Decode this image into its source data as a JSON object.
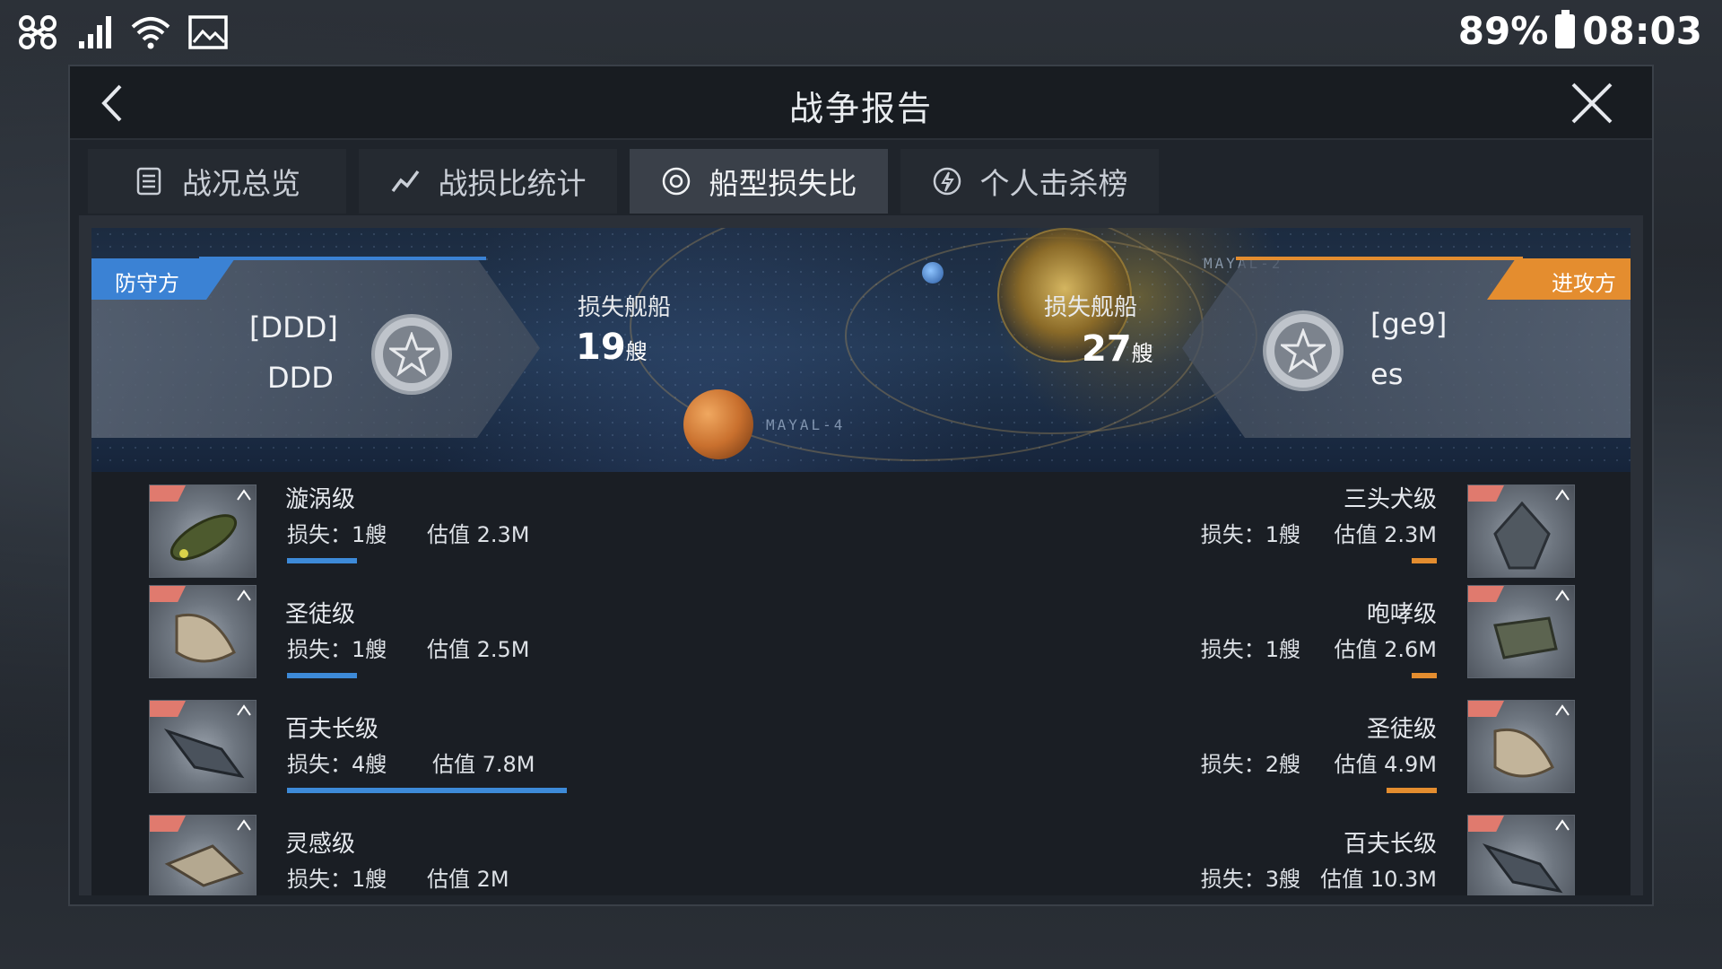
{
  "status_bar": {
    "battery_percent": "89%",
    "time": "08:03"
  },
  "dialog": {
    "title": "战争报告"
  },
  "tabs": [
    {
      "label": "战况总览",
      "icon": "document-icon",
      "active": false
    },
    {
      "label": "战损比统计",
      "icon": "trend-line-icon",
      "active": false
    },
    {
      "label": "船型损失比",
      "icon": "target-icon",
      "active": true
    },
    {
      "label": "个人击杀榜",
      "icon": "lightning-icon",
      "active": false
    }
  ],
  "banner": {
    "map_labels": [
      "MAYAL-4",
      "MAYAL-2"
    ],
    "defender": {
      "side_label": "防守方",
      "guild_tag": "[DDD]",
      "guild_name": "DDD",
      "loss_label": "损失舰船",
      "loss_count": "19",
      "loss_unit": "艘",
      "color": "#3b82d4"
    },
    "attacker": {
      "side_label": "进攻方",
      "guild_tag": "[ge9]",
      "guild_name": "es",
      "loss_label": "损失舰船",
      "loss_count": "27",
      "loss_unit": "艘",
      "color": "#e48d2f"
    }
  },
  "defender_ships": [
    {
      "name": "漩涡级",
      "loss": "损失：1艘",
      "value": "估值 2.3M",
      "bar_fraction": 0.25
    },
    {
      "name": "圣徒级",
      "loss": "损失：1艘",
      "value": "估值 2.5M",
      "bar_fraction": 0.25
    },
    {
      "name": "百夫长级",
      "loss": "损失：4艘",
      "value": "估值 7.8M",
      "bar_fraction": 1.0
    },
    {
      "name": "灵感级",
      "loss": "损失：1艘",
      "value": "估值 2M",
      "bar_fraction": 0.25
    }
  ],
  "attacker_ships": [
    {
      "name": "三头犬级",
      "loss": "损失：1艘",
      "value": "估值 2.3M",
      "bar_fraction": 0.33
    },
    {
      "name": "咆哮级",
      "loss": "损失：1艘",
      "value": "估值 2.6M",
      "bar_fraction": 0.33
    },
    {
      "name": "圣徒级",
      "loss": "损失：2艘",
      "value": "估值 4.9M",
      "bar_fraction": 0.67
    },
    {
      "name": "百夫长级",
      "loss": "损失：3艘",
      "value": "估值 10.3M",
      "bar_fraction": 1.0
    }
  ]
}
